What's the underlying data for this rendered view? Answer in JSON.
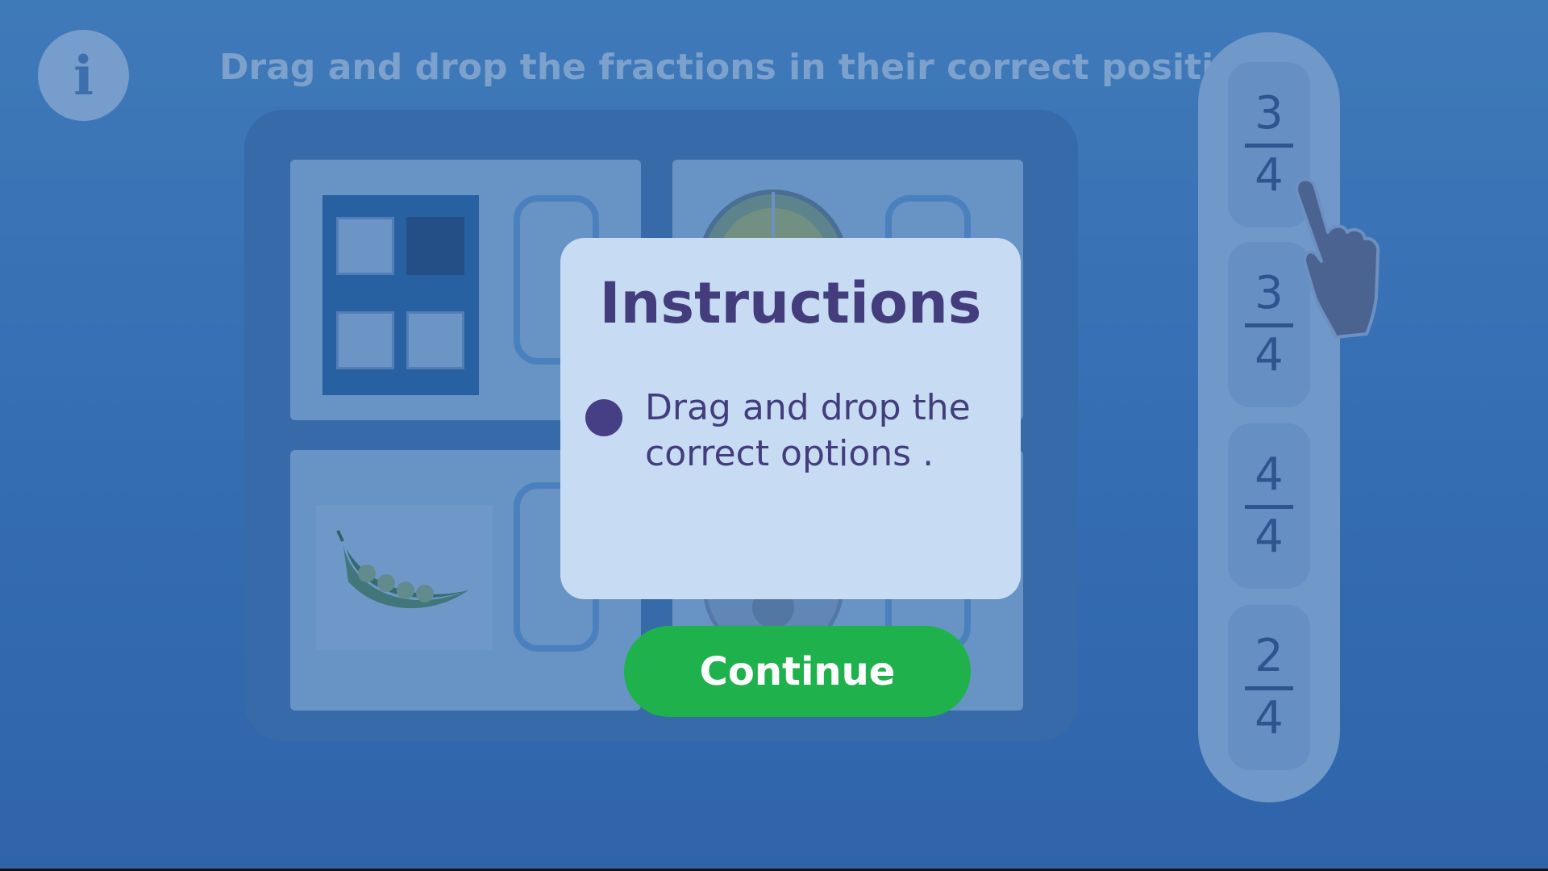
{
  "header": {
    "info_icon": "info-icon",
    "title": "Drag and drop the fractions in their correct position"
  },
  "options": [
    {
      "numerator": "3",
      "denominator": "4"
    },
    {
      "numerator": "3",
      "denominator": "4"
    },
    {
      "numerator": "4",
      "denominator": "4"
    },
    {
      "numerator": "2",
      "denominator": "4"
    }
  ],
  "modal": {
    "title": "Instructions",
    "items": [
      {
        "text": "Drag and drop the correct options ."
      }
    ],
    "continue_label": "Continue"
  },
  "colors": {
    "accent": "#1fb24c",
    "modal_bg": "#c7dcf3",
    "modal_text": "#433d7d"
  }
}
